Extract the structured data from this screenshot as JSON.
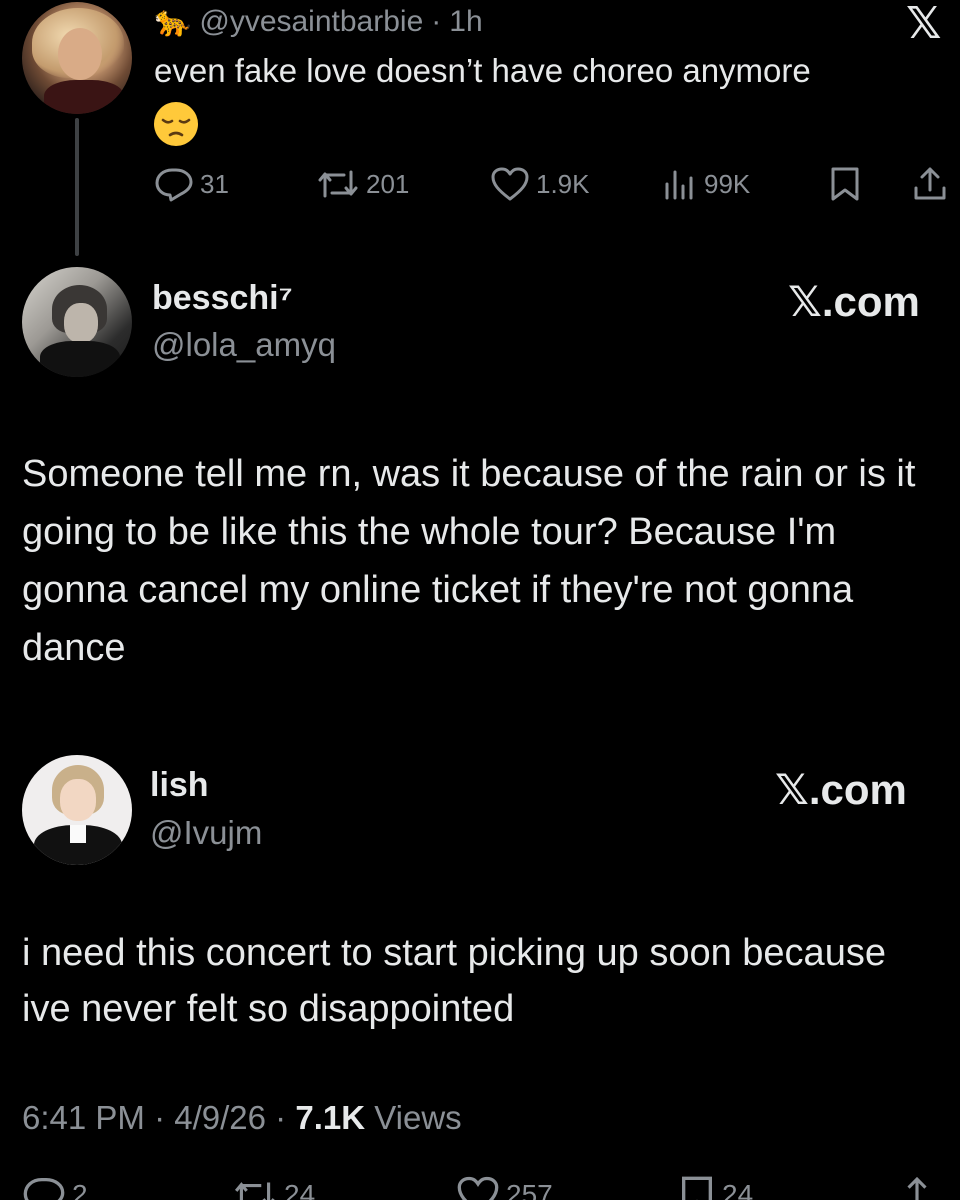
{
  "post1": {
    "handle": "@yvesaintbarbie",
    "separator": "·",
    "time": "1h",
    "text": "even fake love doesn’t have choreo anymore",
    "emoji": "pensive-face",
    "replies": "31",
    "reposts": "201",
    "likes": "1.9K",
    "views": "99K",
    "badge": "🐆"
  },
  "brand": {
    "x_logo": "𝕏",
    "xcom": "𝕏.com"
  },
  "post2": {
    "name": "besschi⁷",
    "handle": "@lola_amyq",
    "text": "Someone tell me rn, was it because of the rain or is it going to be like this the whole tour? Because I'm gonna cancel my online ticket if they're not gonna dance"
  },
  "post3": {
    "name": "lish",
    "handle": "@Ivujm",
    "text": "i need this concert to start picking up soon because ive never felt so disappointed",
    "time": "6:41 PM",
    "sep1": "·",
    "date": "4/9/26",
    "sep2": "·",
    "views_count": "7.1K",
    "views_label": "Views",
    "replies": "2",
    "reposts": "24",
    "likes": "257",
    "bookmarks": "24"
  },
  "colors": {
    "background": "#000000",
    "text": "#e7e9ea",
    "muted": "#8b9096",
    "thread_line": "#3e4144"
  }
}
